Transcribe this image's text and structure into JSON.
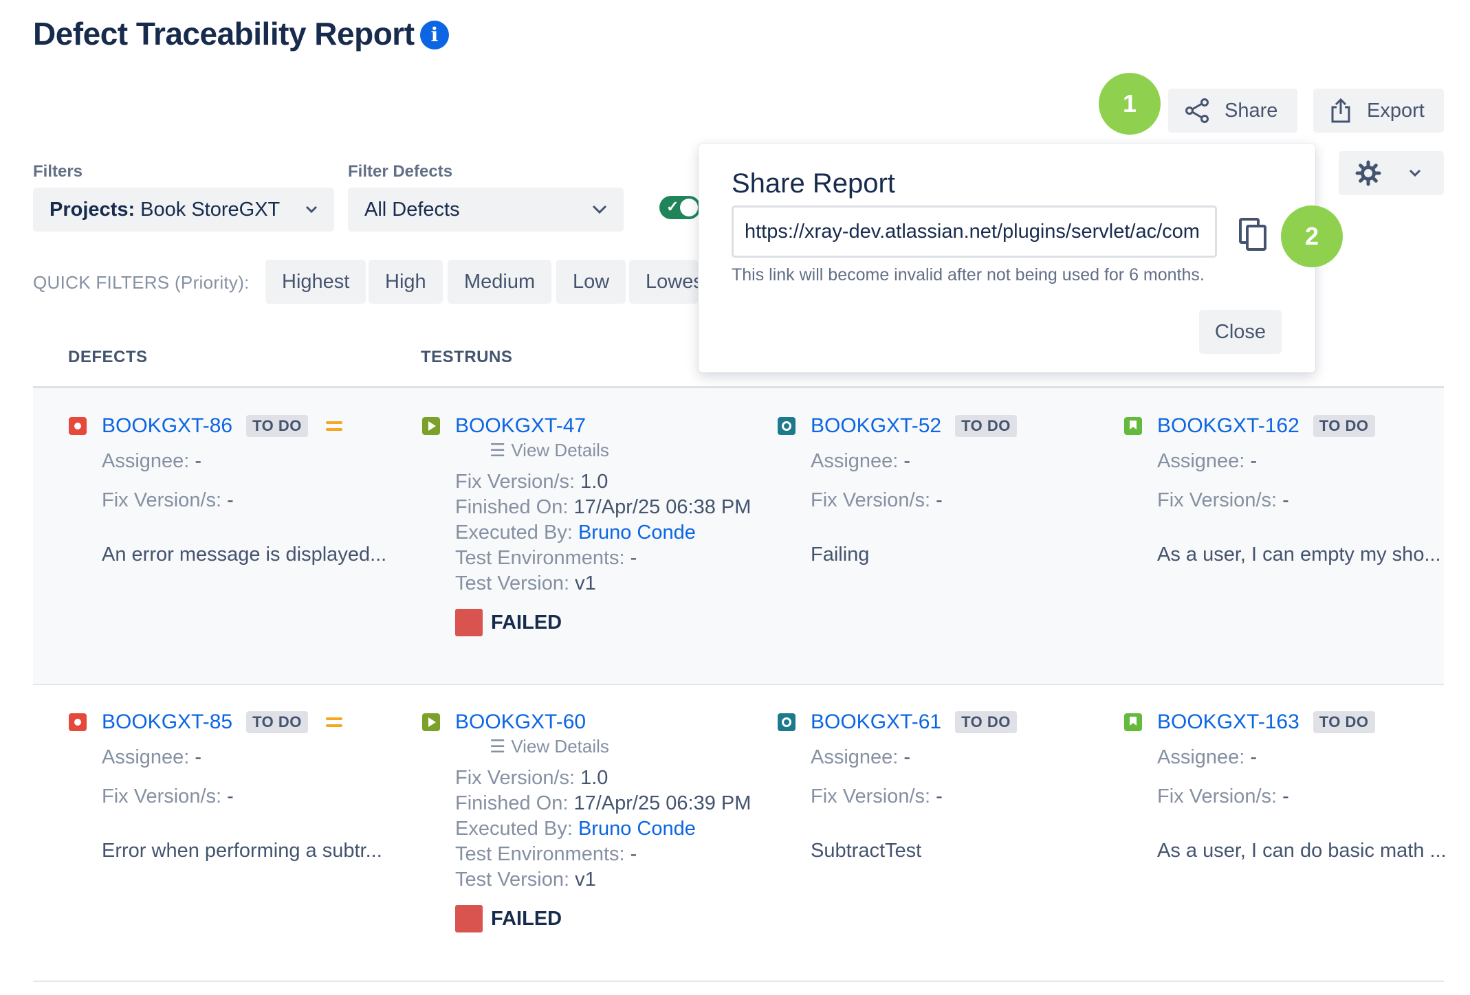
{
  "header": {
    "title": "Defect Traceability Report",
    "info_icon": "i"
  },
  "toolbar": {
    "step1": "1",
    "share_label": "Share",
    "export_label": "Export"
  },
  "filters": {
    "filters_label": "Filters",
    "projects_key": "Projects:",
    "projects_value": "Book StoreGXT",
    "filter_defects_label": "Filter Defects",
    "filter_defects_value": "All Defects"
  },
  "quick_filters": {
    "label": "QUICK FILTERS (Priority):",
    "chips": [
      "Highest",
      "High",
      "Medium",
      "Low",
      "Lowest"
    ]
  },
  "columns": {
    "defects": "DEFECTS",
    "testruns": "TESTRUNS"
  },
  "share_popup": {
    "title": "Share Report",
    "url": "https://xray-dev.atlassian.net/plugins/servlet/ac/com",
    "step2": "2",
    "hint": "This link will become invalid after not being used for 6 months.",
    "close_label": "Close"
  },
  "labels": {
    "assignee": "Assignee:",
    "fix_version": "Fix Version/s:",
    "finished_on": "Finished On:",
    "executed_by": "Executed By:",
    "test_env": "Test Environments:",
    "test_version": "Test Version:",
    "view_details": "View Details"
  },
  "rows": [
    {
      "defect": {
        "key": "BOOKGXT-86",
        "status": "TO DO",
        "assignee": "-",
        "fix_version": "-",
        "summary": "An error message is displayed..."
      },
      "testrun": {
        "key": "BOOKGXT-47",
        "fix_version": "1.0",
        "finished_on": "17/Apr/25 06:38 PM",
        "executed_by": "Bruno Conde",
        "test_env": "-",
        "test_version": "v1",
        "result": "FAILED"
      },
      "test": {
        "key": "BOOKGXT-52",
        "status": "TO DO",
        "assignee": "-",
        "fix_version": "-",
        "summary": "Failing"
      },
      "story": {
        "key": "BOOKGXT-162",
        "status": "TO DO",
        "assignee": "-",
        "fix_version": "-",
        "summary": "As a user, I can empty my sho..."
      }
    },
    {
      "defect": {
        "key": "BOOKGXT-85",
        "status": "TO DO",
        "assignee": "-",
        "fix_version": "-",
        "summary": "Error when performing a subtr..."
      },
      "testrun": {
        "key": "BOOKGXT-60",
        "fix_version": "1.0",
        "finished_on": "17/Apr/25 06:39 PM",
        "executed_by": "Bruno Conde",
        "test_env": "-",
        "test_version": "v1",
        "result": "FAILED"
      },
      "test": {
        "key": "BOOKGXT-61",
        "status": "TO DO",
        "assignee": "-",
        "fix_version": "-",
        "summary": "SubtractTest"
      },
      "story": {
        "key": "BOOKGXT-163",
        "status": "TO DO",
        "assignee": "-",
        "fix_version": "-",
        "summary": "As a user, I can do basic math ..."
      }
    }
  ]
}
